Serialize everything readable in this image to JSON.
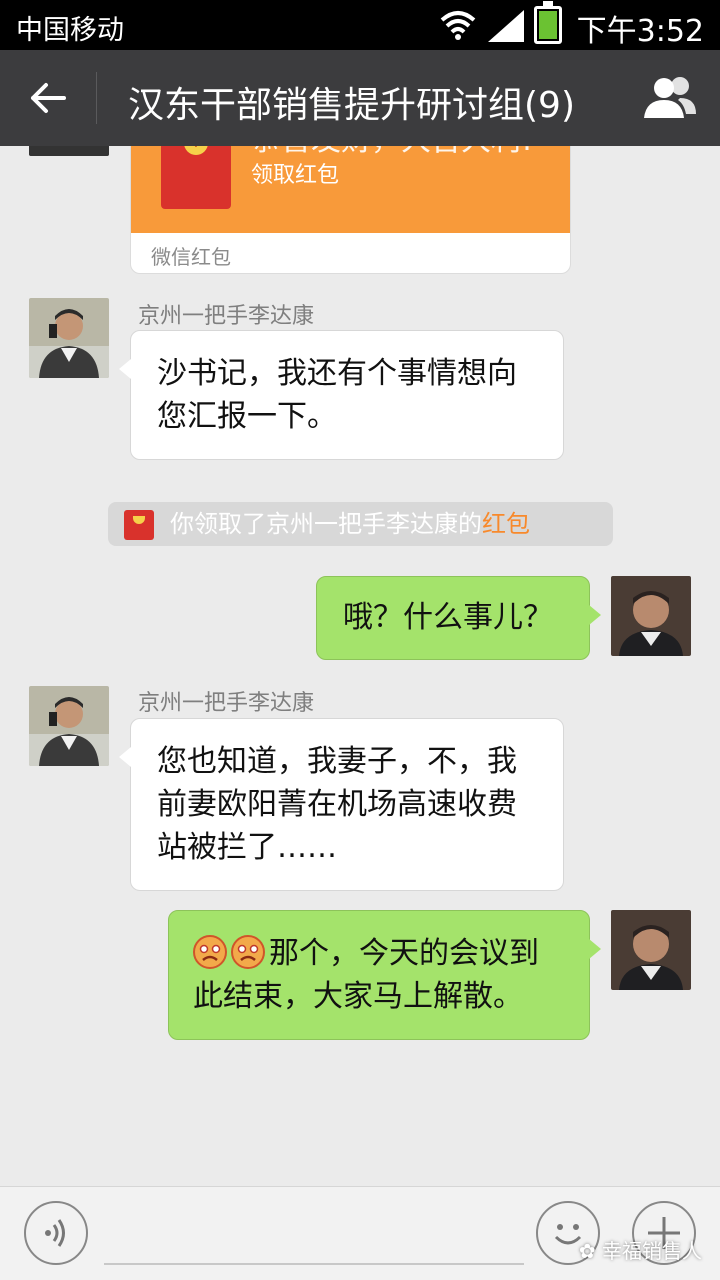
{
  "status_bar": {
    "carrier": "中国移动",
    "time": "下午3:52",
    "icons": [
      "wifi-icon",
      "signal-icon",
      "battery-icon"
    ]
  },
  "header": {
    "title": "汉东干部销售提升研讨组(9)",
    "back_icon": "arrow-left-icon",
    "members_icon": "group-members-icon"
  },
  "messages": {
    "red_packet": {
      "greeting": "恭喜发财，大吉大利!",
      "action": "领取红包",
      "footer": "微信红包"
    },
    "msg1": {
      "sender": "京州一把手李达康",
      "text": "沙书记，我还有个事情想向您汇报一下。"
    },
    "notice": {
      "text": "你领取了京州一把手李达康的",
      "link": "红包"
    },
    "msg2": {
      "text": "哦？什么事儿？"
    },
    "msg3": {
      "sender": "京州一把手李达康",
      "text": "您也知道，我妻子，不，我前妻欧阳菁在机场高速收费站被拦了……"
    },
    "msg4": {
      "emojis": [
        "angry-face-icon",
        "angry-face-icon"
      ],
      "text": "那个，今天的会议到此结束，大家马上解散。"
    }
  },
  "input_bar": {
    "watermark": "幸福销售人",
    "icons": [
      "voice-icon",
      "emoji-icon",
      "plus-icon"
    ]
  },
  "colors": {
    "title_bar": "#3c3c3e",
    "chat_background": "#ebebeb",
    "my_bubble": "#a4e36b",
    "other_bubble": "#ffffff",
    "red_packet": "#f89a3a"
  }
}
